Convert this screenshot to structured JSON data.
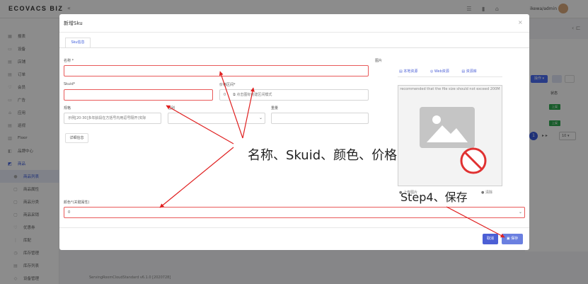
{
  "app": {
    "logo": "ECOVACS BIZ",
    "user": "ikewa/admin",
    "footer": "ServingRoomCloudStandard v6.1.0 [2020728]"
  },
  "sidebar": {
    "items": [
      {
        "label": "报表",
        "icon": "chart-icon"
      },
      {
        "label": "设备",
        "icon": "device-icon"
      },
      {
        "label": "店铺",
        "icon": "store-icon"
      },
      {
        "label": "订单",
        "icon": "order-icon"
      },
      {
        "label": "会员",
        "icon": "member-icon"
      },
      {
        "label": "广告",
        "icon": "ad-icon"
      },
      {
        "label": "应用",
        "icon": "app-icon"
      },
      {
        "label": "巡视",
        "icon": "patrol-icon"
      },
      {
        "label": "Floor",
        "icon": "floor-icon"
      },
      {
        "label": "品牌中心",
        "icon": "brand-icon"
      },
      {
        "label": "商品",
        "icon": "goods-icon"
      },
      {
        "label": "商品列表",
        "icon": "list-icon"
      },
      {
        "label": "商品属性",
        "icon": "attr-icon"
      },
      {
        "label": "商品分类",
        "icon": "category-icon"
      },
      {
        "label": "商品采销",
        "icon": "purchase-icon"
      },
      {
        "label": "优惠券",
        "icon": "coupon-icon"
      },
      {
        "label": "库配",
        "icon": "warehouse-icon"
      },
      {
        "label": "库存管理",
        "icon": "stock-icon"
      },
      {
        "label": "库存列表",
        "icon": "stock-list-icon"
      },
      {
        "label": "设备管理",
        "icon": "device-manage-icon"
      }
    ]
  },
  "background": {
    "ops_button": "操作",
    "state_header": "状态",
    "status_tag": "上架",
    "page": "1",
    "page_size": "10"
  },
  "modal": {
    "title": "新增Sku",
    "tab": "Sku信息",
    "fields": {
      "name": {
        "label": "名称 *",
        "value": ""
      },
      "skuid": {
        "label": "Skuid*",
        "value": ""
      },
      "price_range": {
        "label": "价格区间*",
        "value": "0",
        "hint": "点击图标创建区间模式"
      },
      "specs": {
        "label": "规格",
        "placeholder": "示例[20-30]多年龄段在方括号内用逗号隔开(实际"
      },
      "gender": {
        "label": "性别",
        "value": ""
      },
      "weight": {
        "label": "重量",
        "value": ""
      },
      "color": {
        "label": "颜色*(关键属性)",
        "value": "0"
      }
    },
    "detail_button": "详细信息",
    "image": {
      "label": "图片",
      "sources": [
        "本地资源",
        "Web资源",
        "资源库"
      ],
      "hint": "recommended that the file size should not exceed 200M",
      "actions": "● 上传图片",
      "clear": "● 清除"
    },
    "cancel_button": "取消",
    "save_button": "保存"
  },
  "annotations": {
    "fields_note": "名称、Skuid、颜色、价格",
    "step_note": "Step4、保存",
    "color": "#e02020"
  }
}
